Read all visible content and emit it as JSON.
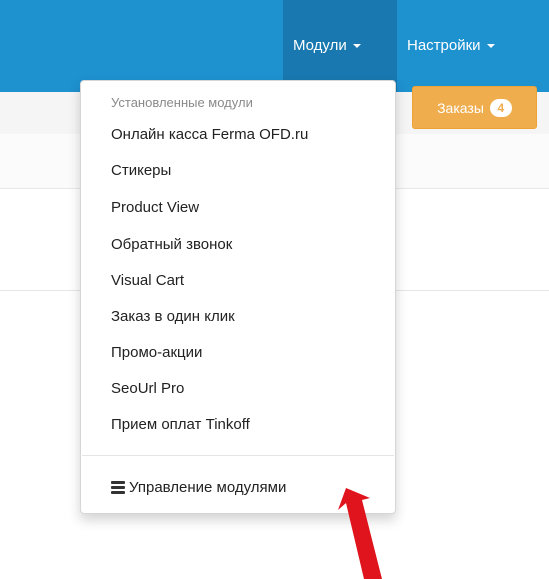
{
  "navbar": {
    "modules_label": "Модули",
    "settings_label": "Настройки",
    "accent": "#1e91cf"
  },
  "toolbar": {
    "orders_label": "Заказы",
    "orders_count": "4",
    "orders_color": "#f0ad4e"
  },
  "dropdown": {
    "header": "Установленные модули",
    "items": [
      "Онлайн касса Ferma OFD.ru",
      "Стикеры",
      "Product View",
      "Обратный звонок",
      "Visual Cart",
      "Заказ в один клик",
      "Промо-акции",
      "SeoUrl Pro",
      "Прием оплат Tinkoff"
    ],
    "manage_label": "Управление модулями",
    "manage_icon": "stack-icon"
  },
  "annotation": {
    "arrow_color": "#e0141c"
  }
}
